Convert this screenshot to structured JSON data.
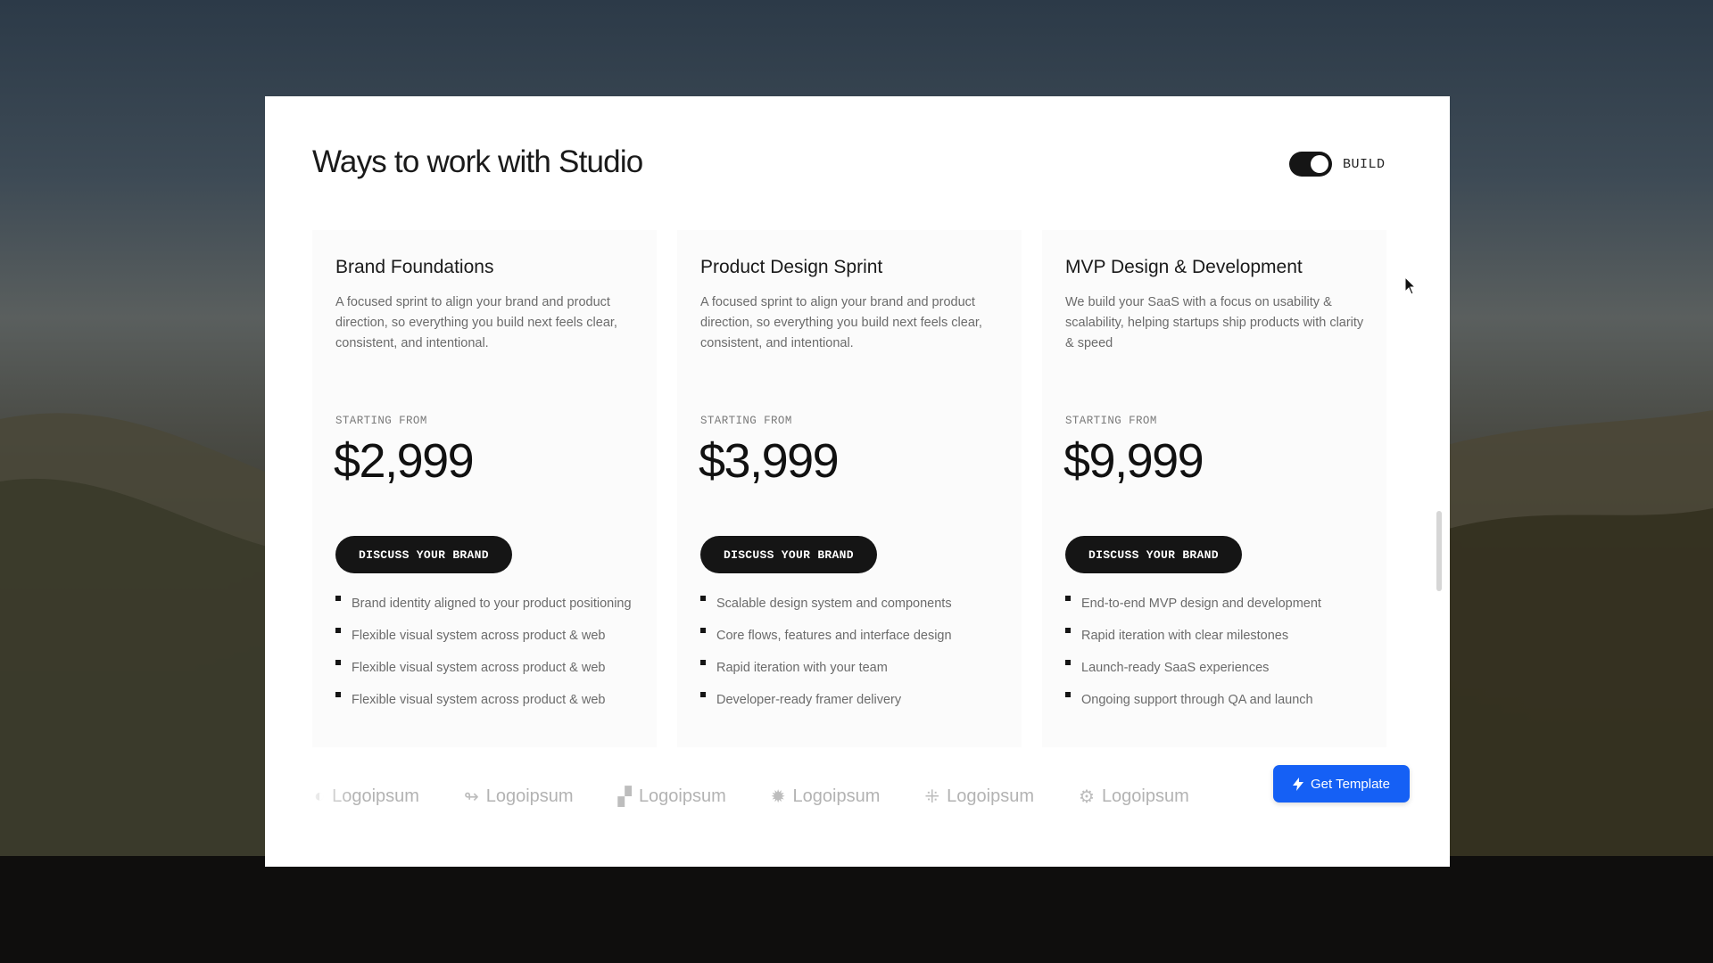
{
  "header": {
    "title": "Ways to work with Studio",
    "toggle_label": "BUILD",
    "toggle_on": true
  },
  "cards": [
    {
      "title": "Brand Foundations",
      "description": "A focused sprint to align your brand and product direction, so everything you build next feels clear, consistent, and intentional.",
      "starting_label": "STARTING FROM",
      "price": "$2,999",
      "cta": "DISCUSS YOUR BRAND",
      "features": [
        "Brand identity aligned to your product positioning",
        "Flexible visual system across product & web",
        "Flexible visual system across product & web",
        "Flexible visual system across product & web"
      ]
    },
    {
      "title": "Product Design Sprint",
      "description": "A focused sprint to align your brand and product direction, so everything you build next feels clear, consistent, and intentional.",
      "starting_label": "STARTING FROM",
      "price": "$3,999",
      "cta": "DISCUSS YOUR BRAND",
      "features": [
        "Scalable design system and components",
        "Core flows, features and interface design",
        "Rapid iteration with your team",
        "Developer-ready framer delivery"
      ]
    },
    {
      "title": "MVP Design & Development",
      "description": "We build your SaaS with a focus on usability & scalability, helping startups ship products with clarity & speed",
      "starting_label": "STARTING FROM",
      "price": "$9,999",
      "cta": "DISCUSS YOUR BRAND",
      "features": [
        "End-to-end MVP design and development",
        "Rapid iteration with clear milestones",
        "Launch-ready SaaS experiences",
        "Ongoing support through QA and launch"
      ]
    }
  ],
  "logos": [
    {
      "name": "Logoipsum",
      "icon": "logo-mark-1"
    },
    {
      "name": "Logoipsum",
      "icon": "logo-swirl"
    },
    {
      "name": "Logoipsum",
      "icon": "logo-blocks"
    },
    {
      "name": "Logoipsum",
      "icon": "logo-gear"
    },
    {
      "name": "Logoipsum",
      "icon": "logo-grid"
    },
    {
      "name": "Logoipsum",
      "icon": "logo-sun"
    }
  ],
  "get_template": {
    "label": "Get Template",
    "icon": "bolt-icon",
    "color": "#1560f5"
  },
  "colors": {
    "button_dark": "#151515",
    "text_muted": "#6b6b6b",
    "accent": "#1560f5"
  }
}
